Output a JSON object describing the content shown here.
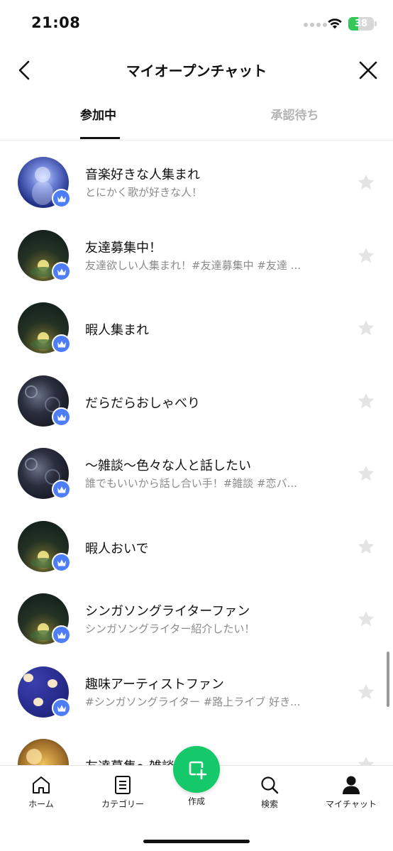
{
  "status_bar": {
    "time": "21:08",
    "battery_percent": "38",
    "battery_level": 0.38,
    "battery_color": "#34c759"
  },
  "header": {
    "title": "マイオープンチャット",
    "back_icon": "chevron-left-icon",
    "close_icon": "close-icon"
  },
  "tabs": [
    {
      "label": "参加中",
      "active": true
    },
    {
      "label": "承認待ち",
      "active": false
    }
  ],
  "chats": [
    {
      "name": "音楽好きな人集まれ",
      "description": "とにかく歌が好きな人！",
      "avatar": "concert",
      "starred": false
    },
    {
      "name": "友達募集中！",
      "description": "友達欲しい人集まれ！#友達募集中 #友達 ...",
      "avatar": "forest",
      "starred": false
    },
    {
      "name": "暇人集まれ",
      "description": "",
      "avatar": "forest",
      "starred": false
    },
    {
      "name": "だらだらおしゃべり",
      "description": "",
      "avatar": "night",
      "starred": false
    },
    {
      "name": "〜雑談〜色々な人と話したい",
      "description": "誰でもいいから話し合い手！#雑談 #恋バ...",
      "avatar": "night",
      "starred": false
    },
    {
      "name": "暇人おいで",
      "description": "",
      "avatar": "forest",
      "starred": false
    },
    {
      "name": "シンガソングライターファン",
      "description": "シンガソングライター紹介したい！",
      "avatar": "forest",
      "starred": false
    },
    {
      "name": "趣味アーティストファン",
      "description": "#シンガソングライター #路上ライブ 好き...",
      "avatar": "pattern",
      "starred": false
    },
    {
      "name": "友達募集〜雑談",
      "description": "",
      "avatar": "bear",
      "starred": false
    }
  ],
  "bottom_nav": {
    "items": [
      {
        "label": "ホーム",
        "icon": "home-icon"
      },
      {
        "label": "カテゴリー",
        "icon": "category-list-icon"
      },
      {
        "label": "検索",
        "icon": "search-icon"
      },
      {
        "label": "マイチャット",
        "icon": "person-icon"
      }
    ],
    "create": {
      "label": "作成",
      "icon": "create-chat-icon",
      "color": "#15c86a"
    }
  },
  "colors": {
    "badge": "#4e7ef7",
    "accent_green": "#15c86a",
    "muted_text": "#8b8b8b",
    "inactive_tab": "#b5b5b5"
  }
}
